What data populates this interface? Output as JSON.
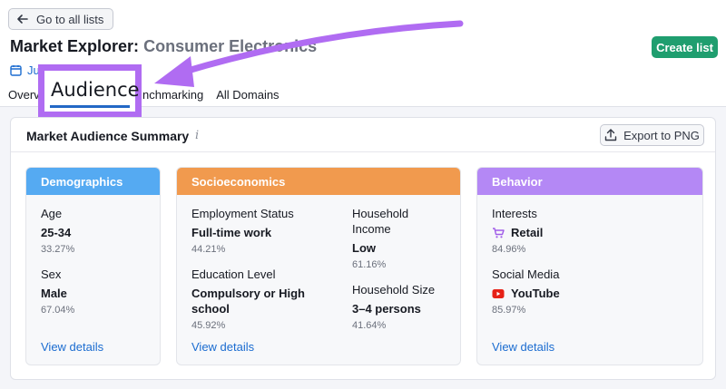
{
  "nav": {
    "back_label": "Go to all lists"
  },
  "header": {
    "title": "Market Explorer:",
    "subtitle": "Consumer Electronics",
    "create_label": "Create list",
    "date_text": "Ju"
  },
  "tabs": {
    "overview": "Overv",
    "benchmarking": "nchmarking",
    "all_domains": "All Domains"
  },
  "highlight": {
    "label": "Audience"
  },
  "summary": {
    "title": "Market Audience Summary",
    "info": "i",
    "export_label": "Export to PNG"
  },
  "panels": {
    "demographics": {
      "title": "Demographics",
      "age": {
        "label": "Age",
        "value": "25-34",
        "pct": "33.27%"
      },
      "sex": {
        "label": "Sex",
        "value": "Male",
        "pct": "67.04%"
      },
      "link": "View details"
    },
    "socioeconomics": {
      "title": "Socioeconomics",
      "employment": {
        "label": "Employment Status",
        "value": "Full-time work",
        "pct": "44.21%"
      },
      "education": {
        "label": "Education Level",
        "value": "Compulsory or High school",
        "pct": "45.92%"
      },
      "income": {
        "label": "Household Income",
        "value": "Low",
        "pct": "61.16%"
      },
      "size": {
        "label": "Household Size",
        "value": "3–4 persons",
        "pct": "41.64%"
      },
      "link": "View details"
    },
    "behavior": {
      "title": "Behavior",
      "interests": {
        "label": "Interests",
        "value": "Retail",
        "pct": "84.96%",
        "icon": "cart-icon"
      },
      "social": {
        "label": "Social Media",
        "value": "YouTube",
        "pct": "85.97%",
        "icon": "youtube-icon"
      },
      "link": "View details"
    }
  },
  "colors": {
    "demographics": "#55aaf2",
    "socioeconomics": "#f19a4e",
    "behavior": "#b488f5",
    "highlight": "#b06cf2",
    "primary_button": "#1f9e6f",
    "link": "#1b6cd0"
  }
}
